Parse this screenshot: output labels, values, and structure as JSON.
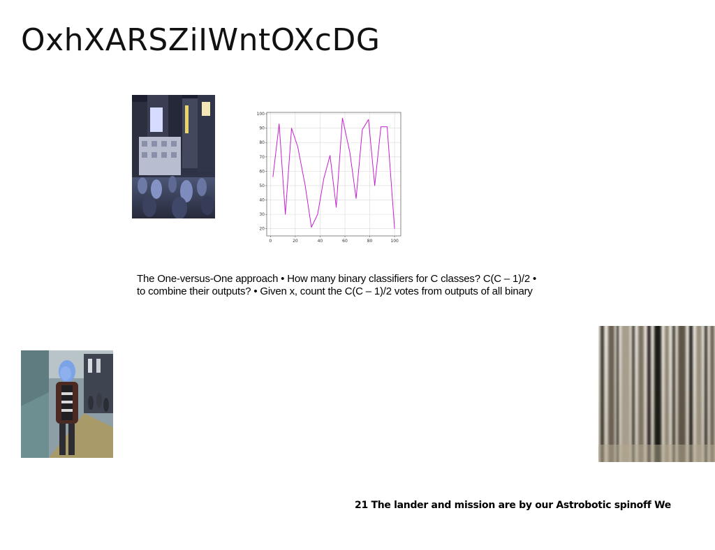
{
  "slide": {
    "title": "OxhXARSZiIWntOXcDG",
    "body_lines": [
      "The One-versus-One approach • How many binary classifiers for C classes? C(C – 1)/2 •",
      "to combine their outputs? • Given x, count the C(C – 1)/2 votes from outputs of all binary"
    ],
    "footer": "21 The lander and mission are by our Astrobotic spinoff We"
  },
  "images": {
    "city": "city-night-crowd-photo",
    "street": "blue-haired-person-street-photo",
    "forest": "blurred-birch-forest-photo"
  },
  "colors": {
    "line": "#c51fd0",
    "grid": "#d9d9d9",
    "axis": "#555555"
  },
  "chart_data": {
    "type": "line",
    "x": [
      2,
      7,
      12,
      17,
      22,
      28,
      33,
      38,
      43,
      48,
      53,
      58,
      64,
      69,
      74,
      79,
      84,
      89,
      94,
      100
    ],
    "values": [
      56,
      93,
      30,
      90,
      77,
      50,
      21,
      30,
      55,
      71,
      35,
      97,
      73,
      41,
      89,
      96,
      50,
      91,
      91,
      20
    ],
    "xlim": [
      -3,
      105
    ],
    "ylim": [
      15,
      101
    ],
    "xticks": [
      0,
      20,
      40,
      60,
      80,
      100
    ],
    "yticks": [
      20,
      30,
      40,
      50,
      60,
      70,
      80,
      90,
      100
    ],
    "grid": true,
    "title": "",
    "xlabel": "",
    "ylabel": ""
  }
}
